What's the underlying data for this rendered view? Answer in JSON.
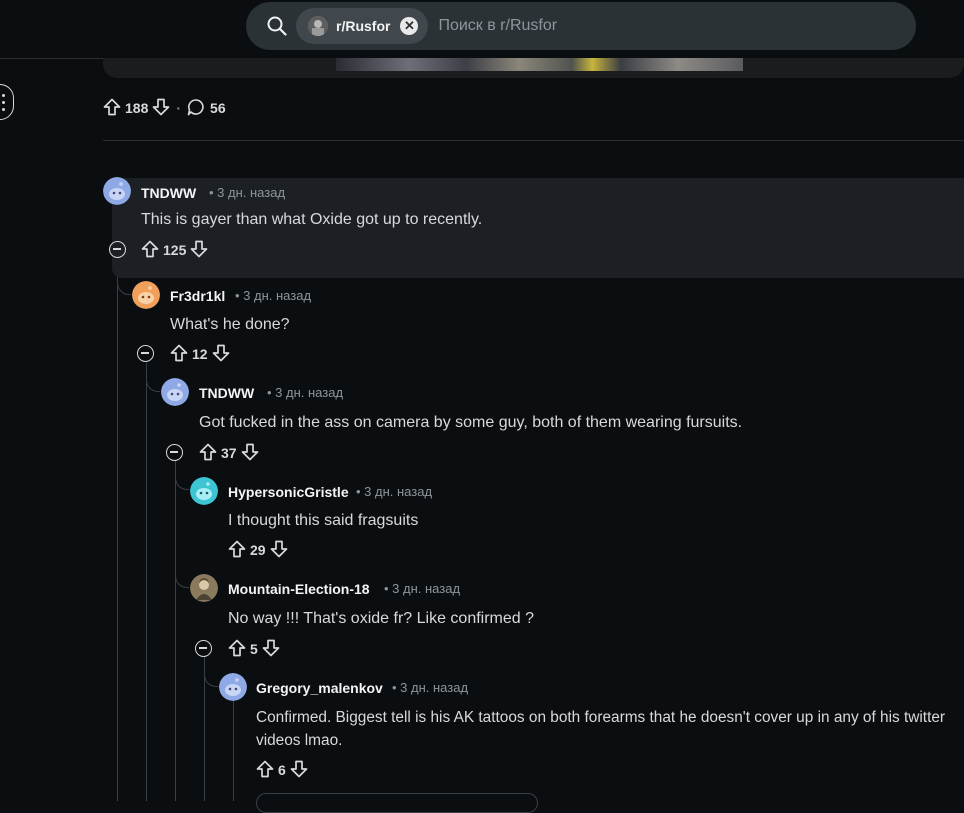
{
  "search": {
    "subreddit_chip": "r/Rusfor",
    "placeholder": "Поиск в r/Rusfor"
  },
  "post": {
    "upvotes": "188",
    "comments": "56"
  },
  "colors": {
    "background": "#0b0e10",
    "highlight": "#1c2024",
    "search_bar": "#2a3236",
    "avatar_blue": "#8fa8e6",
    "avatar_orange": "#f0a05a",
    "avatar_cyan": "#3ec5d4"
  },
  "comments": [
    {
      "user": "TNDWW",
      "time": "• 3 дн. назад",
      "text": "This is gayer than what Oxide got up to recently.",
      "votes": "125",
      "avatar_icon": "snoo-avatar-blue"
    },
    {
      "user": "Fr3dr1kl",
      "time": "• 3 дн. назад",
      "text": "What's he done?",
      "votes": "12",
      "avatar_icon": "snoo-avatar-orange"
    },
    {
      "user": "TNDWW",
      "time": "• 3 дн. назад",
      "text": "Got fucked in the ass on camera by some guy, both of them wearing fursuits.",
      "votes": "37",
      "avatar_icon": "snoo-avatar-blue"
    },
    {
      "user": "HypersonicGristle",
      "time": "• 3 дн. назад",
      "text": "I thought this said fragsuits",
      "votes": "29",
      "avatar_icon": "snoo-avatar-cyan"
    },
    {
      "user": "Mountain-Election-18",
      "time": "• 3 дн. назад",
      "text": "No way !!! That's oxide fr? Like confirmed ?",
      "votes": "5",
      "avatar_icon": "custom-photo-avatar"
    },
    {
      "user": "Gregory_malenkov",
      "time": "• 3 дн. назад",
      "text": "Confirmed. Biggest tell is his AK tattoos on both forearms that he doesn't cover up in any of his twitter videos lmao.",
      "votes": "6",
      "avatar_icon": "snoo-avatar-blue"
    }
  ]
}
